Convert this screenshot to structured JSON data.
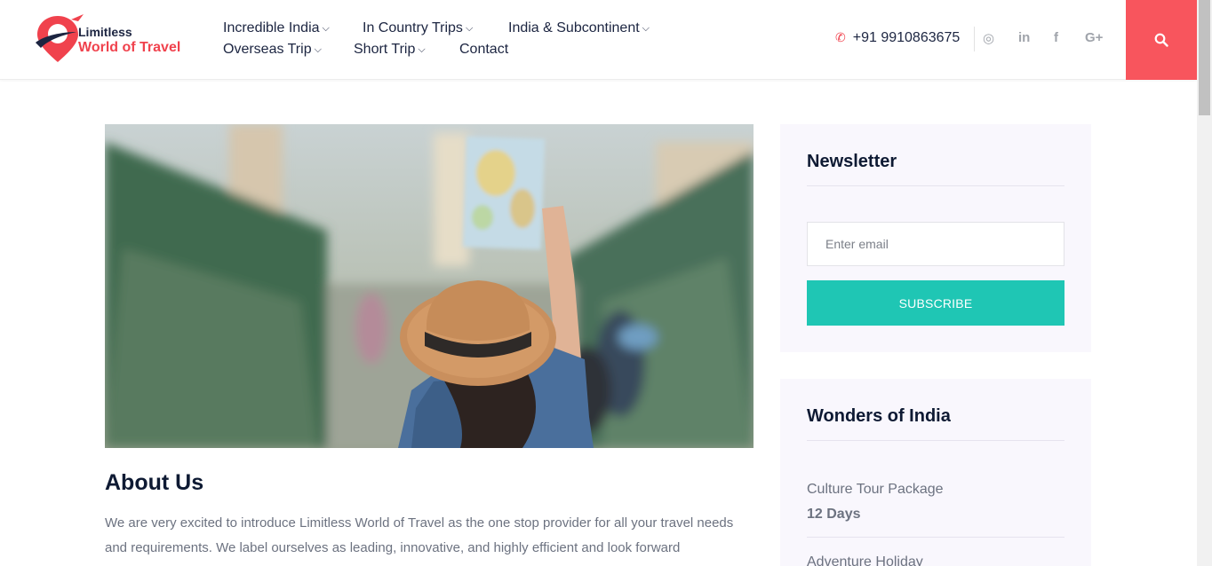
{
  "brand": {
    "name_line1": "Limitless",
    "name_line2": "World of Travel",
    "primary_color": "#f0424d",
    "dark_color": "#1c2541"
  },
  "nav": {
    "items": [
      {
        "label": "Incredible India",
        "has_dropdown": true
      },
      {
        "label": "In Country Trips",
        "has_dropdown": true
      },
      {
        "label": "India & Subcontinent",
        "has_dropdown": true
      },
      {
        "label": "Overseas Trip",
        "has_dropdown": true
      },
      {
        "label": "Short Trip",
        "has_dropdown": true
      },
      {
        "label": "Contact",
        "has_dropdown": false
      }
    ],
    "chevron": "⌵"
  },
  "header": {
    "phone": "+91 9910863675",
    "phone_icon": "phone-icon",
    "socials": [
      {
        "icon": "instagram-icon",
        "glyph": "◎"
      },
      {
        "icon": "linkedin-icon",
        "glyph": "in"
      },
      {
        "icon": "facebook-icon",
        "glyph": "f"
      },
      {
        "icon": "google-plus-icon",
        "glyph": "G+"
      }
    ],
    "search_icon": "search-icon",
    "accent": "#f8555d"
  },
  "about": {
    "title": "About Us",
    "text": "We are very excited to introduce Limitless World of Travel as the one stop provider for all your travel needs and requirements. We label ourselves as leading, innovative, and highly efficient and look forward"
  },
  "newsletter": {
    "title": "Newsletter",
    "email_placeholder": "Enter email",
    "subscribe_label": "SUBSCRIBE",
    "button_color": "#1fc6b4"
  },
  "wonders": {
    "title": "Wonders of India",
    "tours": [
      {
        "name": "Culture Tour Package",
        "days": "12 Days"
      },
      {
        "name": "Adventure Holiday",
        "days": ""
      }
    ]
  }
}
